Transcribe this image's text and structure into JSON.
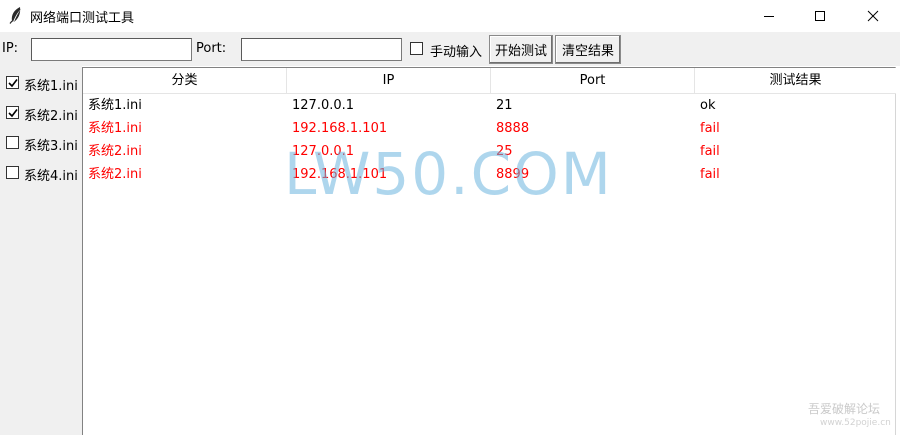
{
  "window": {
    "title": "网络端口测试工具",
    "icon": "feather-icon",
    "controls": [
      "minimize-icon",
      "maximize-icon",
      "close-icon"
    ]
  },
  "toolbar": {
    "ip_label": "IP:",
    "ip_value": "",
    "port_label": "Port:",
    "port_value": "",
    "manual_label": "手动输入",
    "manual_checked": false,
    "start_button": "开始测试",
    "clear_button": "清空结果"
  },
  "sidebar": {
    "items": [
      {
        "label": "系统1.ini",
        "checked": true
      },
      {
        "label": "系统2.ini",
        "checked": true
      },
      {
        "label": "系统3.ini",
        "checked": false
      },
      {
        "label": "系统4.ini",
        "checked": false
      }
    ]
  },
  "table": {
    "columns": [
      "分类",
      "IP",
      "Port",
      "测试结果"
    ],
    "rows": [
      {
        "category": "系统1.ini",
        "ip": "127.0.0.1",
        "port": "21",
        "result": "ok",
        "status": "ok"
      },
      {
        "category": "系统1.ini",
        "ip": "192.168.1.101",
        "port": "8888",
        "result": "fail",
        "status": "fail"
      },
      {
        "category": "系统2.ini",
        "ip": "127.0.0.1",
        "port": "25",
        "result": "fail",
        "status": "fail"
      },
      {
        "category": "系统2.ini",
        "ip": "192.168.1.101",
        "port": "8899",
        "result": "fail",
        "status": "fail"
      }
    ]
  },
  "colors": {
    "fail_text": "#ff0000",
    "watermark": "#6cb4de"
  },
  "watermark": {
    "text": "LW50.COM",
    "corner_text": "吾爱破解论坛",
    "corner_sub": "www.52pojie.cn"
  }
}
